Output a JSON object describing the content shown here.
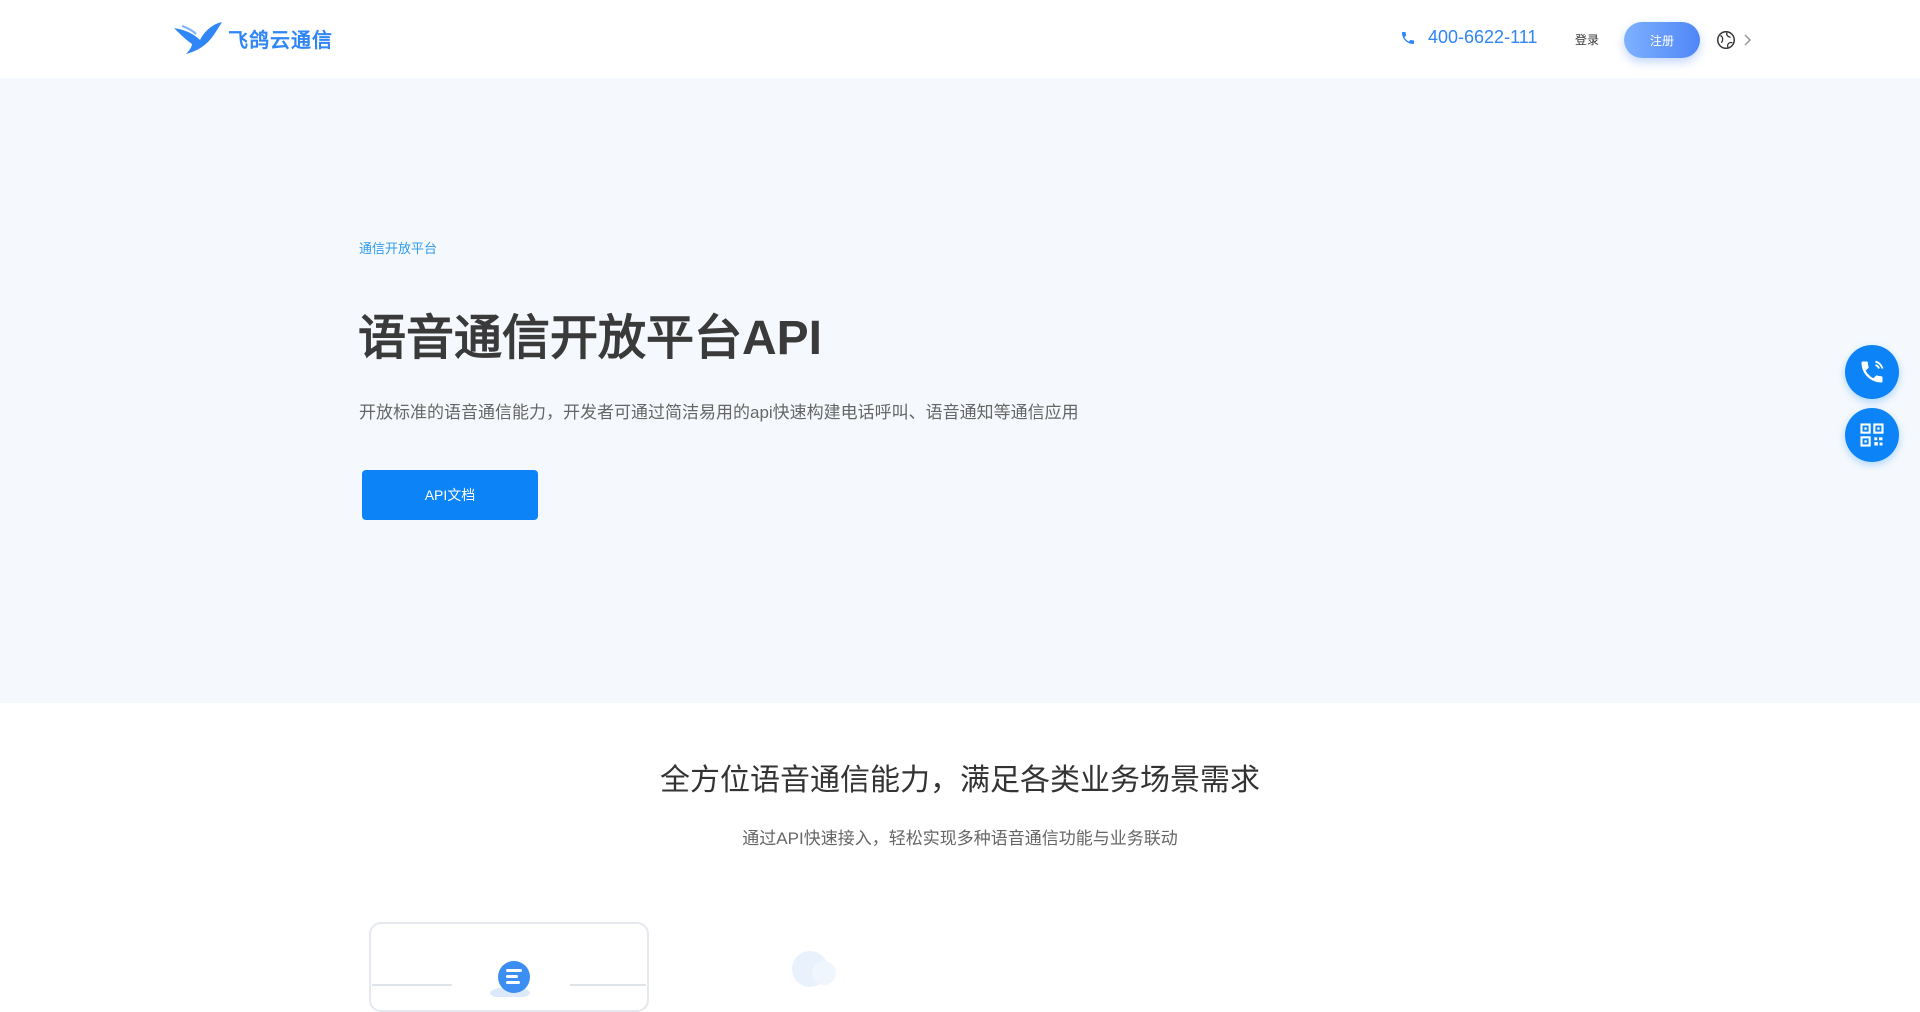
{
  "header": {
    "logo_text": "飞鸽云通信",
    "phone": "400-6622-111",
    "nav_link": "登录",
    "cta_button": "注册",
    "globe_icon": "globe-icon",
    "chevron_icon": "chevron-right-icon"
  },
  "hero": {
    "eyebrow": "通信开放平台",
    "title": "语音通信开放平台API",
    "description": "开放标准的语音通信能力，开发者可通过简洁易用的api快速构建电话呼叫、语音通知等通信应用",
    "button": "API文档"
  },
  "floating": {
    "phone_icon": "phone-call-icon",
    "qr_icon": "qr-code-icon"
  },
  "section": {
    "title": "全方位语音通信能力，满足各类业务场景需求",
    "subtitle": "通过API快速接入，轻松实现多种语音通信功能与业务联动"
  },
  "colors": {
    "brand": "#2f86f6",
    "primary_button": "#0c84f7",
    "hero_bg": "#f5f9fd"
  }
}
